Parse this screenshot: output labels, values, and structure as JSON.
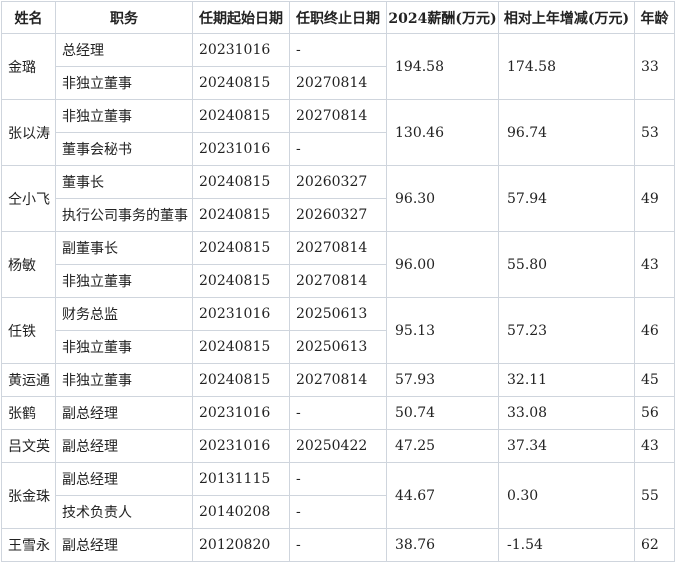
{
  "headers": [
    "姓名",
    "职务",
    "任期起始日期",
    "任职终止日期",
    "2024薪酬(万元)",
    "相对上年增减(万元)",
    "年龄"
  ],
  "people": [
    {
      "name": "金璐",
      "salary": "194.58",
      "change": "174.58",
      "age": "33",
      "roles": [
        {
          "title": "总经理",
          "start": "20231016",
          "end": "-"
        },
        {
          "title": "非独立董事",
          "start": "20240815",
          "end": "20270814"
        }
      ]
    },
    {
      "name": "张以涛",
      "salary": "130.46",
      "change": "96.74",
      "age": "53",
      "roles": [
        {
          "title": "非独立董事",
          "start": "20240815",
          "end": "20270814"
        },
        {
          "title": "董事会秘书",
          "start": "20231016",
          "end": "-"
        }
      ]
    },
    {
      "name": "仝小飞",
      "salary": "96.30",
      "change": "57.94",
      "age": "49",
      "roles": [
        {
          "title": "董事长",
          "start": "20240815",
          "end": "20260327"
        },
        {
          "title": "执行公司事务的董事",
          "start": "20240815",
          "end": "20260327"
        }
      ]
    },
    {
      "name": "杨敏",
      "salary": "96.00",
      "change": "55.80",
      "age": "43",
      "roles": [
        {
          "title": "副董事长",
          "start": "20240815",
          "end": "20270814"
        },
        {
          "title": "非独立董事",
          "start": "20240815",
          "end": "20270814"
        }
      ]
    },
    {
      "name": "任铁",
      "salary": "95.13",
      "change": "57.23",
      "age": "46",
      "roles": [
        {
          "title": "财务总监",
          "start": "20231016",
          "end": "20250613"
        },
        {
          "title": "非独立董事",
          "start": "20240815",
          "end": "20250613"
        }
      ]
    },
    {
      "name": "黄运通",
      "salary": "57.93",
      "change": "32.11",
      "age": "45",
      "roles": [
        {
          "title": "非独立董事",
          "start": "20240815",
          "end": "20270814"
        }
      ]
    },
    {
      "name": "张鹤",
      "salary": "50.74",
      "change": "33.08",
      "age": "56",
      "roles": [
        {
          "title": "副总经理",
          "start": "20231016",
          "end": "-"
        }
      ]
    },
    {
      "name": "吕文英",
      "salary": "47.25",
      "change": "37.34",
      "age": "43",
      "roles": [
        {
          "title": "副总经理",
          "start": "20231016",
          "end": "20250422"
        }
      ]
    },
    {
      "name": "张金珠",
      "salary": "44.67",
      "change": "0.30",
      "age": "55",
      "roles": [
        {
          "title": "副总经理",
          "start": "20131115",
          "end": "-"
        },
        {
          "title": "技术负责人",
          "start": "20140208",
          "end": "-"
        }
      ]
    },
    {
      "name": "王雪永",
      "salary": "38.76",
      "change": "-1.54",
      "age": "62",
      "roles": [
        {
          "title": "副总经理",
          "start": "20120820",
          "end": "-"
        }
      ]
    }
  ]
}
